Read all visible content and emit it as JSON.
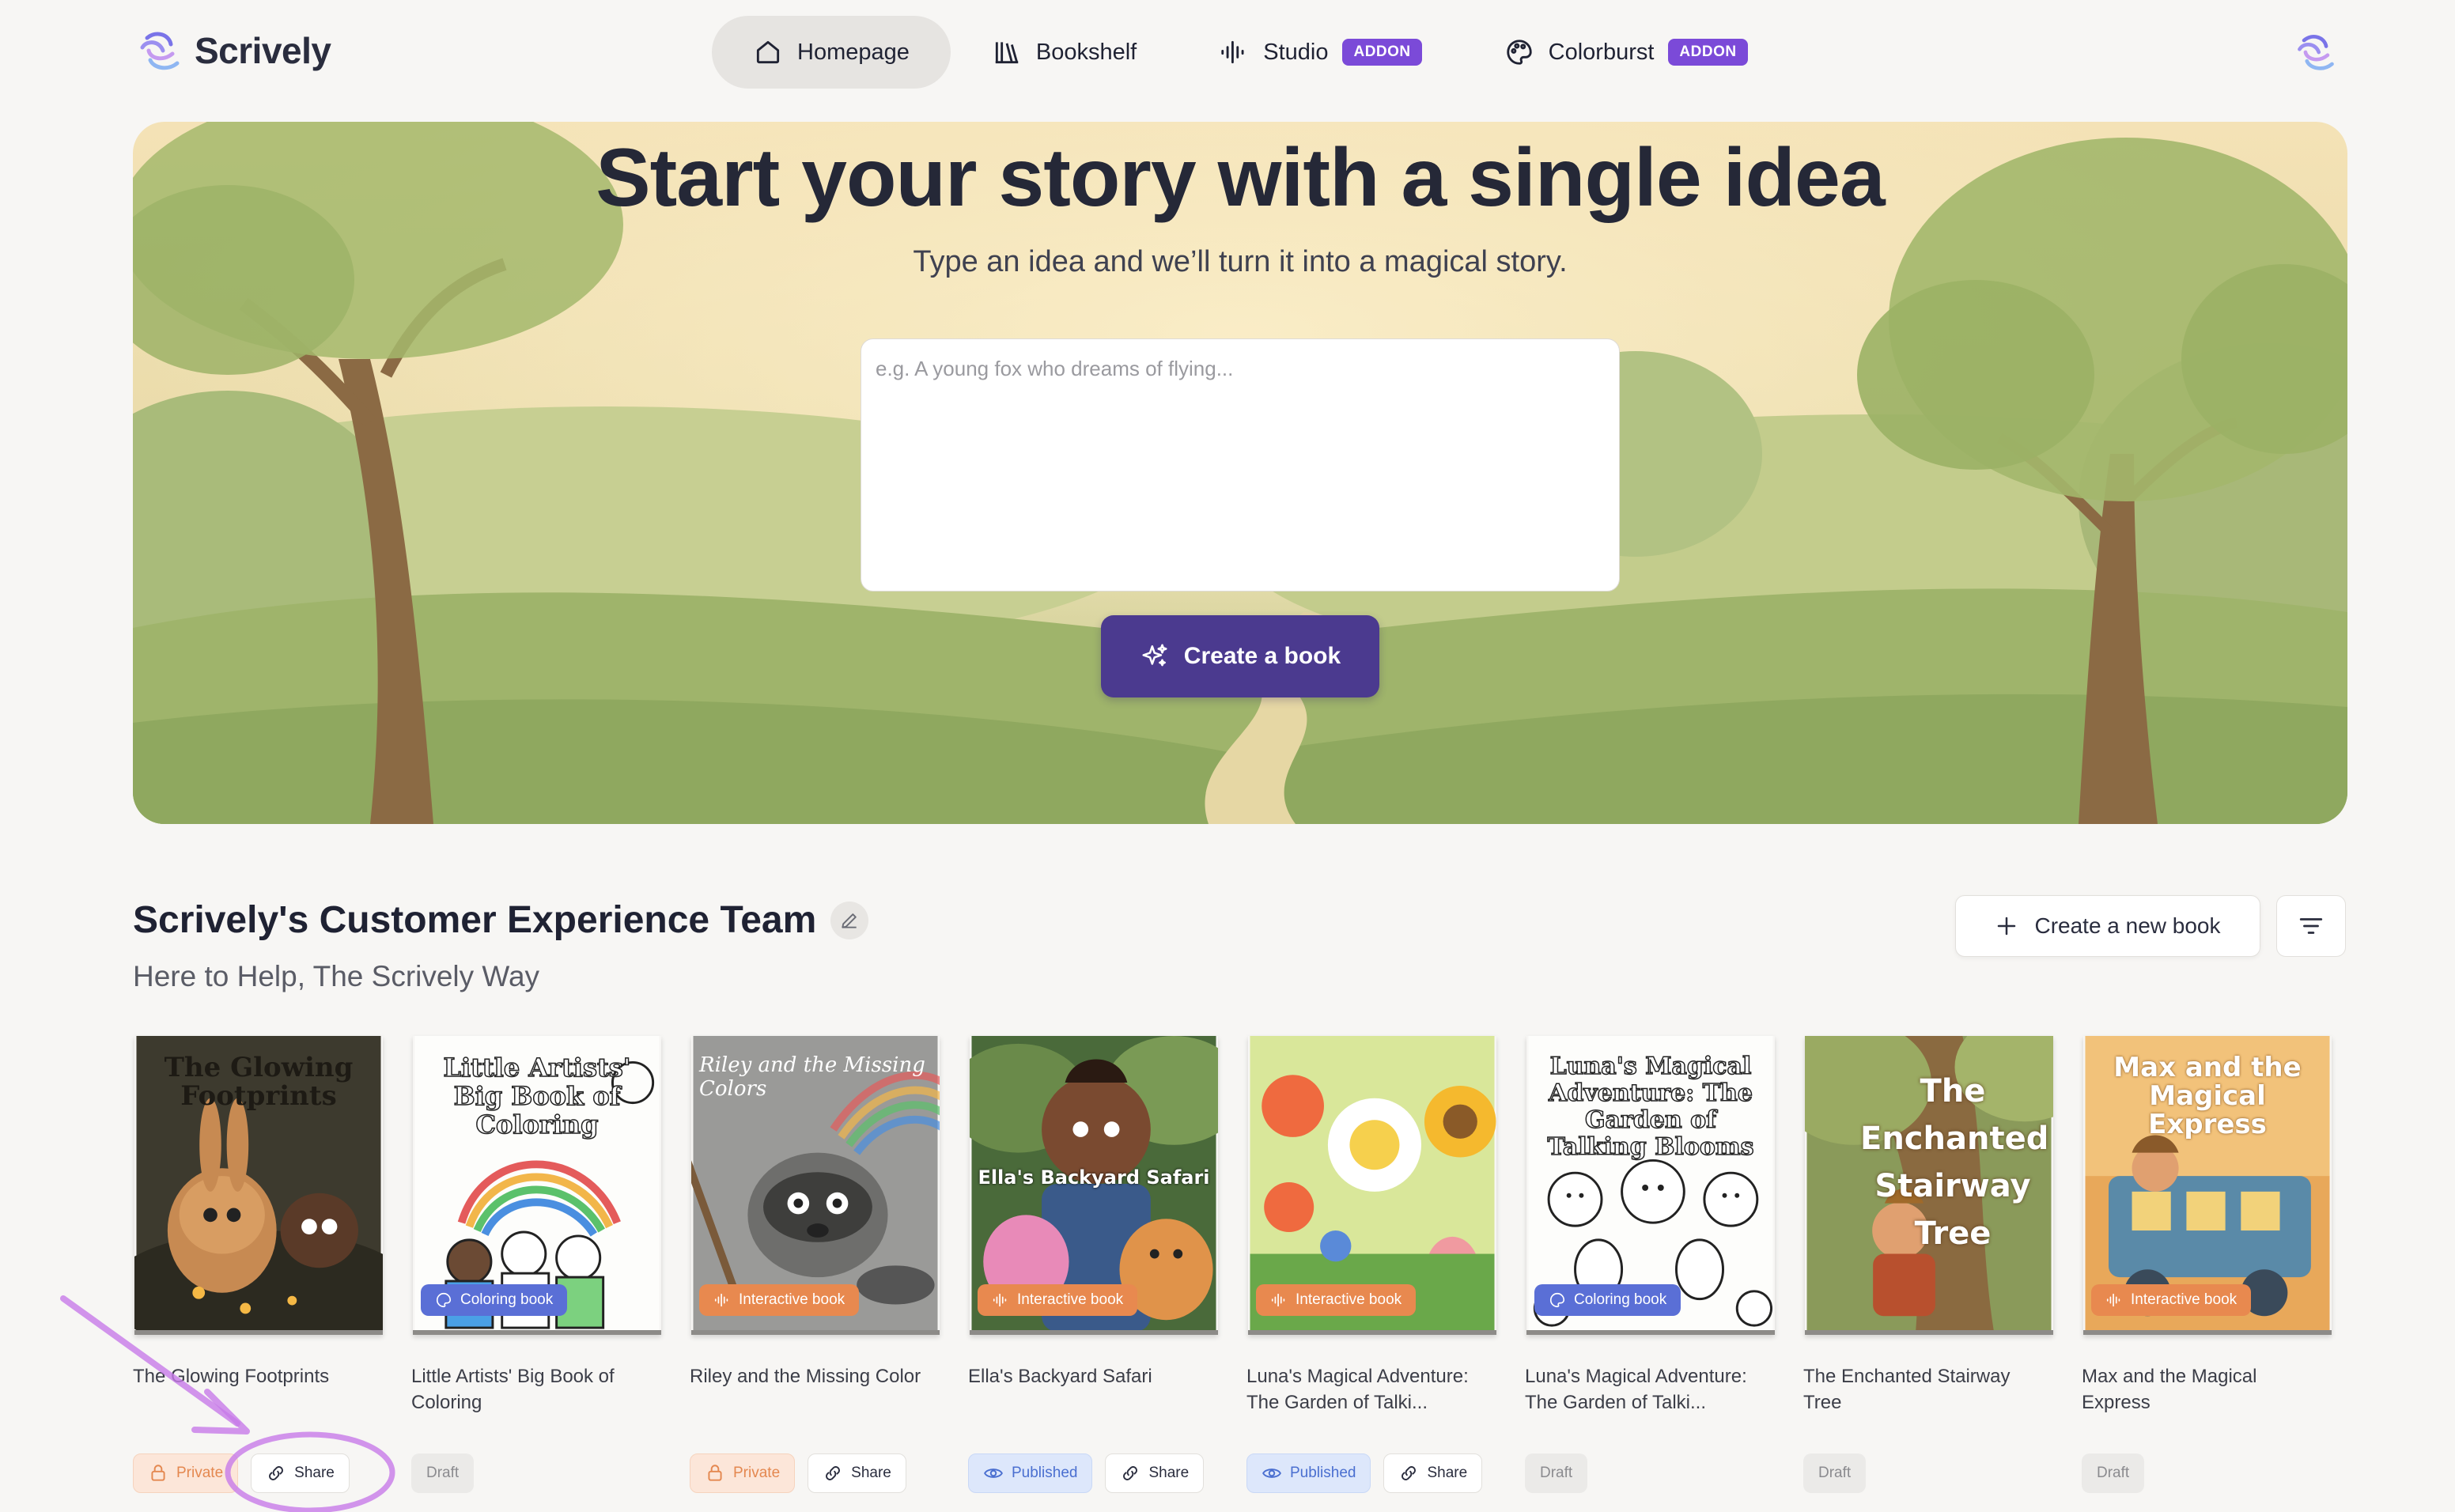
{
  "app": {
    "name": "Scrively"
  },
  "nav": {
    "items": [
      {
        "label": "Homepage",
        "icon": "home-icon",
        "active": true
      },
      {
        "label": "Bookshelf",
        "icon": "books-icon",
        "active": false
      },
      {
        "label": "Studio",
        "icon": "audio-wave-icon",
        "badge": "ADDON",
        "active": false
      },
      {
        "label": "Colorburst",
        "icon": "palette-icon",
        "badge": "ADDON",
        "active": false
      }
    ]
  },
  "hero": {
    "title": "Start your story with a single idea",
    "subtitle": "Type an idea and we’ll turn it into a magical story.",
    "placeholder": "e.g. A young fox who dreams of flying...",
    "create_label": "Create a book"
  },
  "team": {
    "title": "Scrively's Customer Experience Team",
    "subtitle": "Here to Help, The Scrively Way",
    "new_book_label": "Create a new book"
  },
  "books": [
    {
      "title": "The Glowing Footprints",
      "cover_text": "The Glowing Footprints",
      "type": "",
      "status": "Private",
      "share": "Share"
    },
    {
      "title": "Little Artists' Big Book of Coloring",
      "cover_text": "Little Artists' Big Book of Coloring",
      "type": "Coloring book",
      "status": "Draft",
      "share": ""
    },
    {
      "title": "Riley and the Missing Color",
      "cover_text": "Riley and the Missing Colors",
      "type": "Interactive book",
      "status": "Private",
      "share": "Share"
    },
    {
      "title": "Ella's Backyard Safari",
      "cover_text": "Ella's Backyard Safari",
      "type": "Interactive book",
      "status": "Published",
      "share": "Share"
    },
    {
      "title": "Luna's Magical Adventure: The Garden of Talki...",
      "cover_text": "",
      "type": "Interactive book",
      "status": "Published",
      "share": "Share"
    },
    {
      "title": "Luna's Magical Adventure: The Garden of Talki...",
      "cover_text": "Luna's Magical Adventure: The Garden of Talking Blooms",
      "type": "Coloring book",
      "status": "Draft",
      "share": ""
    },
    {
      "title": "The Enchanted Stairway Tree",
      "cover_text": "The Enchanted Stairway Tree",
      "type": "",
      "status": "Draft",
      "share": ""
    },
    {
      "title": "Max and the Magical Express",
      "cover_text": "Max and the Magical Express",
      "type": "Interactive book",
      "status": "Draft",
      "share": ""
    }
  ],
  "colors": {
    "accent": "#4b3a8f",
    "addon_badge": "#7b4ad8",
    "annotation": "#c77be8"
  }
}
